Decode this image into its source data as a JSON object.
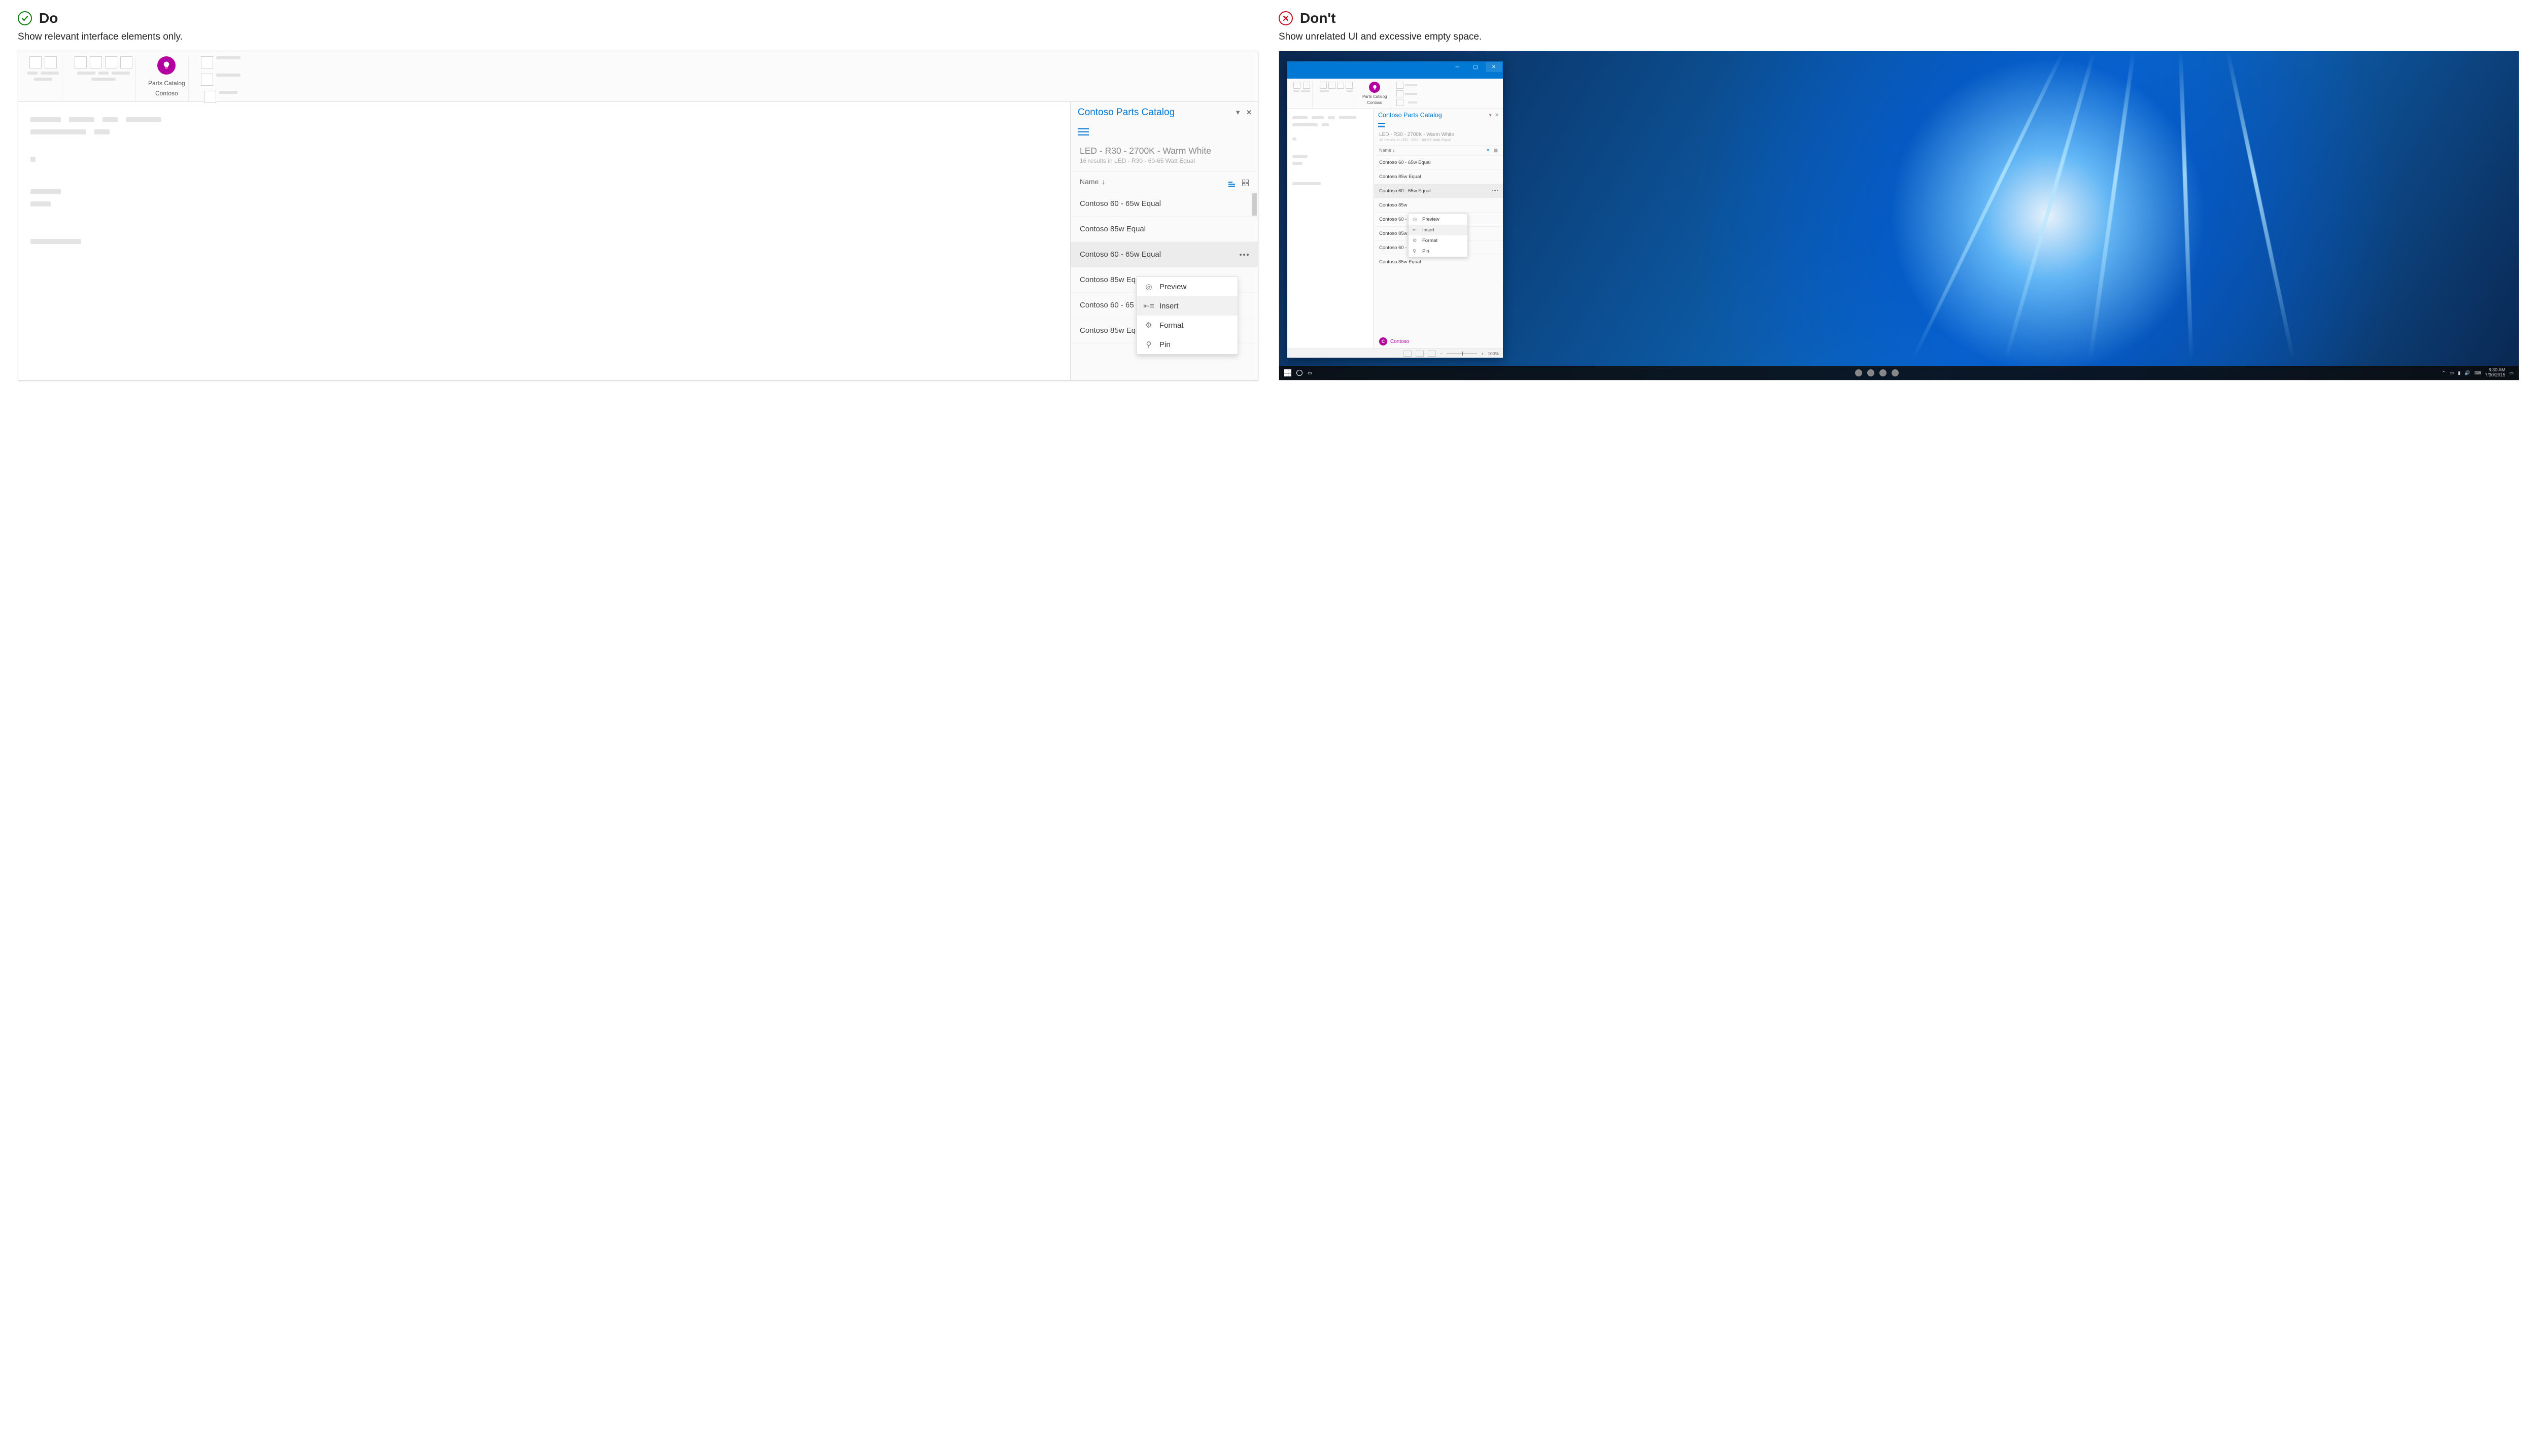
{
  "do": {
    "heading": "Do",
    "subtitle": "Show relevant interface elements only.",
    "ribbon": {
      "label_line1": "Parts Catalog",
      "label_line2": "Contoso"
    },
    "pane": {
      "title": "Contoso Parts Catalog",
      "breadcrumb": "LED - R30 - 2700K - Warm White",
      "subresults": "16 results in LED - R30 - 60-65 Watt Equal",
      "sort_label": "Name",
      "rows": [
        "Contoso 60 - 65w Equal",
        "Contoso 85w Equal",
        "Contoso 60 - 65w Equal",
        "Contoso 85w Eq",
        "Contoso 60 - 65",
        "Contoso 85w Eq"
      ],
      "menu": {
        "preview": "Preview",
        "insert": "Insert",
        "format": "Format",
        "pin": "Pin"
      }
    }
  },
  "dont": {
    "heading": "Don't",
    "subtitle": "Show unrelated UI and excessive empty space.",
    "ribbon": {
      "label_line1": "Parts Catalog",
      "label_line2": "Contoso"
    },
    "pane": {
      "title": "Contoso Parts Catalog",
      "breadcrumb": "LED - R30 - 2700K - Warm White",
      "subresults": "16 results in LED - R30 - 60-65 Watt Equal",
      "sort_label": "Name",
      "rows": [
        "Contoso 60 - 65w Equal",
        "Contoso 85w Equal",
        "Contoso 60 - 65w Equal",
        "Contoso 85w",
        "Contoso 60 - 65",
        "Contoso 85w Eq",
        "Contoso 60 - 65w Equal",
        "Contoso 85w Equal"
      ],
      "menu": {
        "preview": "Preview",
        "insert": "Insert",
        "format": "Format",
        "pin": "Pin"
      },
      "footer_name": "Contoso",
      "footer_initial": "C"
    },
    "statusbar": {
      "zoom": "100%"
    },
    "taskbar": {
      "time": "6:30 AM",
      "date": "7/30/2015"
    }
  }
}
